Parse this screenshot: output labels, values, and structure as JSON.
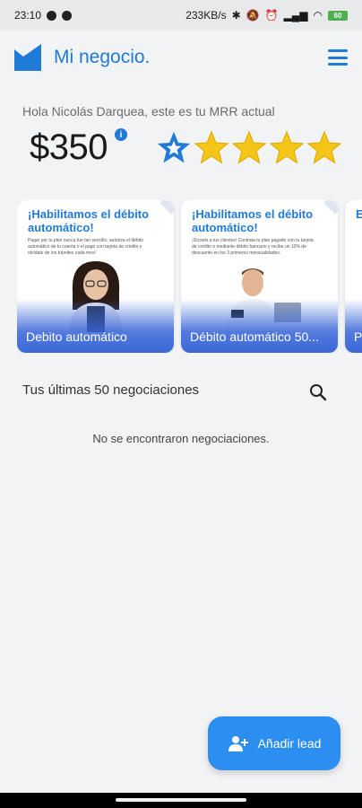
{
  "status_bar": {
    "time": "23:10",
    "speed": "233KB/s",
    "battery": "60"
  },
  "app": {
    "title": "Mi negocio.",
    "brand_color": "#1f7ad8"
  },
  "dashboard": {
    "greeting": "Hola Nicolás Darquea, este es tu MRR actual",
    "mrr_value": "$350",
    "info_icon": "i",
    "rating": {
      "first_star_style": "outlined-blue",
      "gold_stars": 4,
      "total_stars": 5
    }
  },
  "promos": [
    {
      "headline": "¡Habilitamos el débito automático!",
      "body": "Pagar por tu plan nunca fue tan sencillo, autoriza el débito automático de tu cuenta o el pago con tarjeta de crédito y olvídate de los trámites cada mes!",
      "label": "Debito automático"
    },
    {
      "headline": "¡Habilitamos el débito automático!",
      "body": "¡Dícselo a tus clientes! Contrata tu plan pagado con tu tarjeta de crédito o mediante débito bancario y recibe un 10% de descuento en los 3 primeros mensualidades.",
      "label": "Débito automático 50..."
    },
    {
      "headline": "E",
      "label": "Pl"
    }
  ],
  "negotiations": {
    "title": "Tus últimas 50 negociaciones",
    "empty_message": "No se encontraron negociaciones."
  },
  "fab": {
    "label": "Añadir lead",
    "icon": "add-person-icon"
  }
}
